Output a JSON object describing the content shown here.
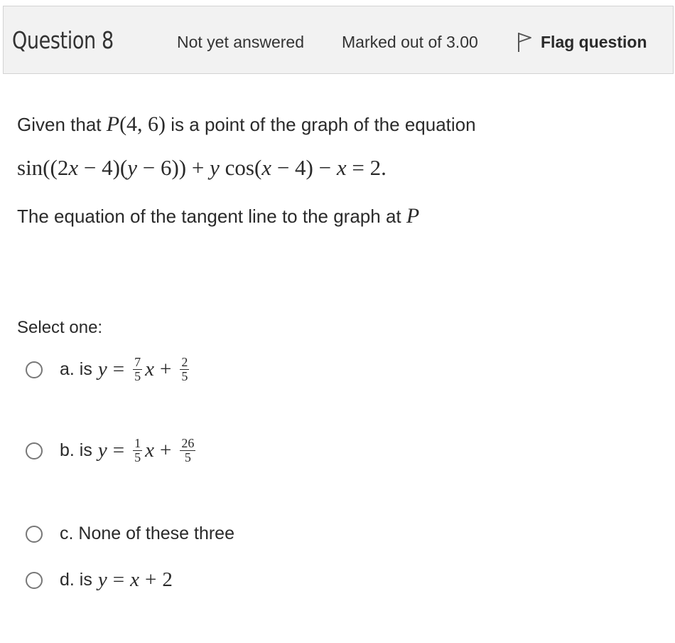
{
  "header": {
    "question_number": "Question 8",
    "state": "Not yet answered",
    "grade": "Marked out of 3.00",
    "flag_label": "Flag question",
    "flag_icon": "flag-outline-icon"
  },
  "question": {
    "intro_prefix": "Given that ",
    "intro_point": "P(4, 6)",
    "intro_suffix": " is a point of the graph of the equation",
    "equation": "sin((2x − 4)(y − 6)) + y cos(x − 4) − x = 2.",
    "tangent_prefix": "The equation of the tangent line to the graph at ",
    "tangent_point": "P"
  },
  "answer": {
    "prompt": "Select one:",
    "options": [
      {
        "label": "a. is",
        "expr": "y = 7/5 x + 2/5",
        "frac1_num": "7",
        "frac1_den": "5",
        "frac2_num": "2",
        "frac2_den": "5"
      },
      {
        "label": "b. is",
        "expr": "y = 1/5 x + 26/5",
        "frac1_num": "1",
        "frac1_den": "5",
        "frac2_num": "26",
        "frac2_den": "5"
      },
      {
        "label": "c. None of these three"
      },
      {
        "label": "d. is",
        "expr": "y = x + 2"
      }
    ]
  }
}
